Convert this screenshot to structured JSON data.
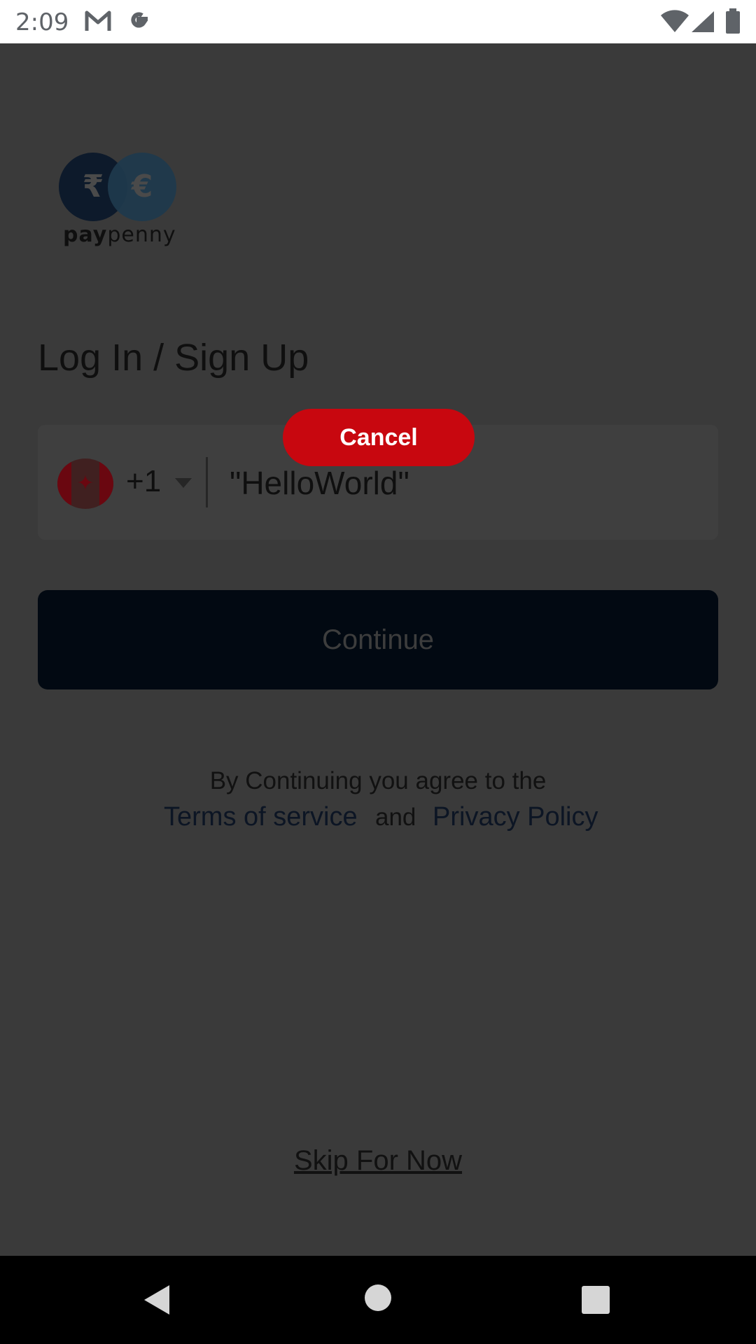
{
  "status_bar": {
    "time": "2:09",
    "icons": [
      "gmail-icon",
      "google-icon",
      "wifi-icon",
      "signal-icon",
      "battery-icon"
    ]
  },
  "app": {
    "logo_text_bold": "pay",
    "logo_text_light": "penny",
    "logo_symbols": [
      "₹",
      "€"
    ]
  },
  "login": {
    "title": "Log In / Sign Up",
    "country_flag": "canada-flag-icon",
    "dial_code": "+1",
    "phone_value": "\"HelloWorld\"",
    "continue_label": "Continue",
    "agree_text": "By Continuing you agree to the",
    "terms_label": "Terms of service",
    "and_label": "and",
    "privacy_label": "Privacy Policy",
    "skip_label": "Skip For Now"
  },
  "overlay": {
    "cancel_label": "Cancel"
  },
  "colors": {
    "cancel": "#c8070f",
    "continue": "#020912",
    "scrim": "#3a3a3a"
  }
}
